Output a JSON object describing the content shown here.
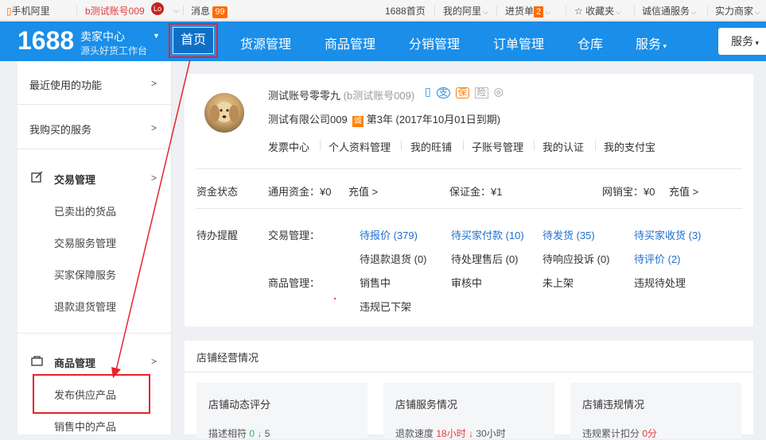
{
  "topbar": {
    "mobile": "手机阿里",
    "account": "b测试账号009",
    "account_badge": "Lo",
    "messages": "消息",
    "messages_count": "99",
    "home1688": "1688首页",
    "my_alibaba": "我的阿里",
    "purchase": "进货单",
    "purchase_count": "2",
    "favorites": "收藏夹",
    "credit_service": "诚信通服务",
    "power_merchant": "实力商家"
  },
  "nav": {
    "logo": "1688",
    "seller_center": "卖家中心",
    "seller_sub": "源头好货工作台",
    "items": [
      "首页",
      "货源管理",
      "商品管理",
      "分销管理",
      "订单管理",
      "仓库",
      "服务"
    ],
    "service_button": "服务"
  },
  "sidebar": {
    "recent": "最近使用的功能",
    "bought_services": "我购买的服务",
    "trade_mgmt": "交易管理",
    "trade_items": [
      "已卖出的货品",
      "交易服务管理",
      "买家保障服务",
      "退款退货管理"
    ],
    "product_mgmt": "商品管理",
    "product_items": [
      "发布供应产品",
      "销售中的产品"
    ],
    "arrow": ">"
  },
  "account": {
    "name": "测试账号零零九",
    "name_sub": "(b测试账号009)",
    "icons": [
      "phone-icon",
      "alipay-icon",
      "guarantee-icon",
      "insurance-icon",
      "credit-icon"
    ],
    "company": "测试有限公司009",
    "year_badge": "诚",
    "year_text": "第3年 (2017年10月01日到期)",
    "links": [
      "发票中心",
      "个人资料管理",
      "我的旺铺",
      "子账号管理",
      "我的认证",
      "我的支付宝"
    ]
  },
  "funds": {
    "label": "资金状态",
    "general": "通用资金：¥0",
    "recharge1": "充值 >",
    "deposit": "保证金：¥1",
    "netbank": "网销宝：¥0",
    "recharge2": "充值 >"
  },
  "todo": {
    "label": "待办提醒",
    "trade_label": "交易管理：",
    "trade_items": [
      "待报价 (379)",
      "待买家付款 (10)",
      "待发货 (35)",
      "待买家收货 (3)",
      "待退款退货 (0)",
      "待处理售后 (0)",
      "待响应投诉 (0)",
      "待评价 (2)"
    ],
    "product_label": "商品管理：",
    "product_items": [
      "销售中",
      "审核中",
      "未上架",
      "违规待处理",
      "违规已下架"
    ]
  },
  "shop": {
    "title": "店铺经营情况",
    "box1_title": "店铺动态评分",
    "box1_row_label": "描述相符",
    "box1_v1": "0",
    "box1_arrow": "↓",
    "box1_v2": "5",
    "box2_title": "店铺服务情况",
    "box2_row_label": "退款速度",
    "box2_v1": "18小时",
    "box2_arrow": "↓",
    "box2_v2": "30小时",
    "box3_title": "店铺违规情况",
    "box3_row_label": "违规累计扣分",
    "box3_v1": "0分"
  },
  "colors": {
    "nav_bg": "#1a8ee8",
    "accent_orange": "#ff6a00",
    "link_blue": "#1c6fcc",
    "annotation_red": "#e8232b"
  }
}
